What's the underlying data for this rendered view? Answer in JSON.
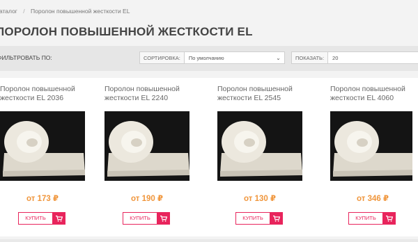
{
  "breadcrumb": {
    "items": [
      "Каталог",
      "Поролон повышенной жесткости EL"
    ],
    "separator": "/"
  },
  "page": {
    "title": "ПОРОЛОН ПОВЫШЕННОЙ ЖЕСТКОСТИ EL"
  },
  "toolbar": {
    "filter_label": "ФИЛЬТРОВАТЬ ПО:",
    "sort": {
      "label": "СОРТИРОВКА:",
      "value": "По умолчанию"
    },
    "show": {
      "label": "ПОКАЗАТЬ:",
      "value": "20"
    }
  },
  "products": [
    {
      "title": "Поролон повышенной жесткости EL 2036",
      "price": "от 173 ₽",
      "buy_label": "КУПИТЬ",
      "icon": "cart-icon"
    },
    {
      "title": "Поролон повышенной жесткости EL 2240",
      "price": "от 190 ₽",
      "buy_label": "КУПИТЬ",
      "icon": "cart-icon"
    },
    {
      "title": "Поролон повышенной жесткости EL 2545",
      "price": "от 130 ₽",
      "buy_label": "КУПИТЬ",
      "icon": "cart-icon"
    },
    {
      "title": "Поролон повышенной жесткости EL 4060",
      "price": "от 346 ₽",
      "buy_label": "КУПИТЬ",
      "icon": "cart-icon"
    }
  ],
  "colors": {
    "accent": "#e8245c",
    "price": "#f0963c",
    "toolbar_bg": "#e6e6e6"
  }
}
